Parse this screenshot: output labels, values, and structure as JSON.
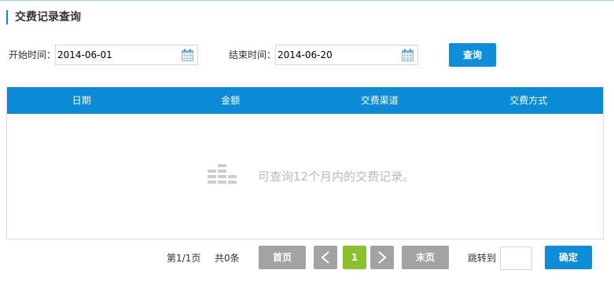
{
  "page": {
    "title": "交费记录查询"
  },
  "filters": {
    "start_label": "开始时间：",
    "start_value": "2014-06-01",
    "end_label": "结束时间：",
    "end_value": "2014-06-20",
    "calendar_icon": "calendar-icon",
    "query_button": "查询"
  },
  "table": {
    "columns": [
      "日期",
      "金额",
      "交费渠道",
      "交费方式"
    ],
    "empty_icon": "empty-data-icon",
    "empty_text": "可查询12个月内的交费记录。"
  },
  "pagination": {
    "page_info": "第1/1页",
    "total_info": "共0条",
    "first_label": "首页",
    "prev_label": "<",
    "current_page": "1",
    "next_label": ">",
    "last_label": "末页",
    "jump_label": "跳转到",
    "jump_value": "",
    "confirm_label": "确定"
  },
  "colors": {
    "accent": "#0b8ad6",
    "button": "#0f8dd9",
    "current_page": "#8cbf2e",
    "pager_button": "#a3a3a3",
    "empty_text": "#b9b9b9"
  }
}
